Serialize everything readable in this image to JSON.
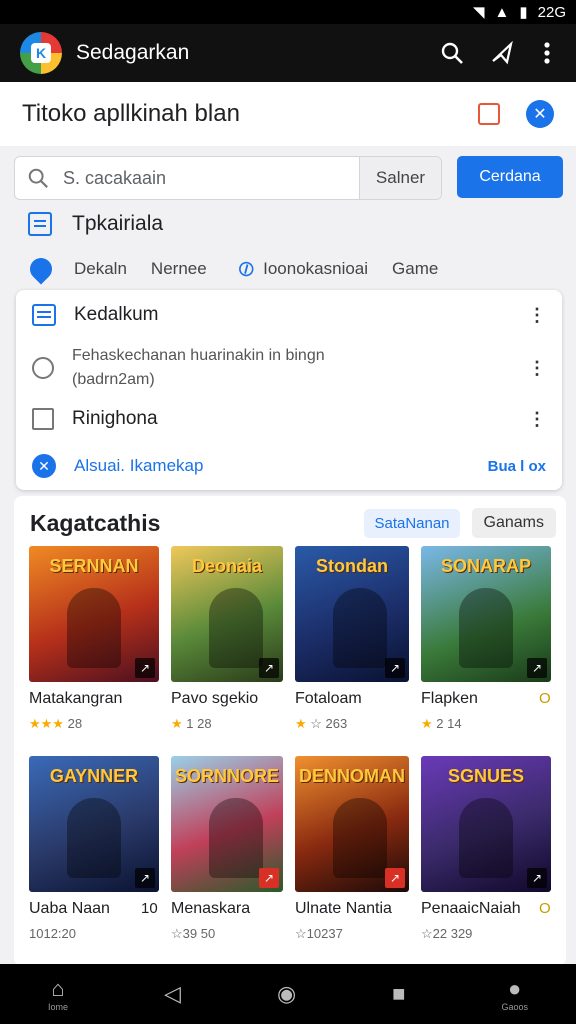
{
  "status": {
    "right_text": "22G"
  },
  "appbar": {
    "title": "Sedagarkan",
    "logo_glyph": "K"
  },
  "header": {
    "title": "Titoko apllkinah blan"
  },
  "search": {
    "placeholder": "S. cacakaain",
    "side_button": "Salner",
    "primary_button": "Cerdana"
  },
  "section": {
    "title": "Tpkairiala"
  },
  "chips": {
    "a": "Dekaln",
    "b": "Nernee",
    "c": "Ioonokasnioai",
    "d": "Game"
  },
  "card": {
    "row1": "Kedalkum",
    "row2_line1": "Fehaskechanan huarinakin in bingn",
    "row2_line2": "(badrn2am)",
    "row3": "Rinighona",
    "link": "Alsuai. Ikamekap",
    "link_right": "Bua l ox"
  },
  "games": {
    "title": "Kagatcathis",
    "pill_active": "SataNanan",
    "pill": "Ganams",
    "items": [
      {
        "art": "SERNNAN",
        "name": "Matakangran",
        "stars": "★★★",
        "meta": "28",
        "bg": "linear-gradient(160deg,#f08a24,#b6301a 55%,#4a1020)"
      },
      {
        "art": "Deonaia",
        "name": "Pavo sgekio",
        "stars": "★",
        "meta": "1 28",
        "bg": "linear-gradient(160deg,#f0c85a,#5a8a3a 55%,#2a3a1a)"
      },
      {
        "art": "Stondan",
        "name": "Fotaloam",
        "stars": "★",
        "meta": "☆ 263",
        "bg": "linear-gradient(160deg,#2a5aa8,#1c2e6a 55%,#0a1230)"
      },
      {
        "art": "SONARAP",
        "name": "Flapken",
        "stars": "★",
        "meta": "2 14",
        "bg": "linear-gradient(160deg,#7ab8e8,#3a7a3a 60%,#1a3a1a)",
        "extra": "O"
      },
      {
        "art": "GAYNNER",
        "name": "Uaba Naan",
        "stars": "",
        "meta": "1012:20",
        "bg": "linear-gradient(160deg,#3a6ab8,#2a3a6a 55%,#0a1230)",
        "extra": "10"
      },
      {
        "art": "SORNNORE",
        "name": "Menaskara",
        "stars": "",
        "meta": "☆39 50",
        "bg": "linear-gradient(160deg,#9ad0e8,#c0405a 55%,#2a5a2a)"
      },
      {
        "art": "DENNOMAN",
        "name": "Ulnate Nantia",
        "stars": "",
        "meta": "☆10237",
        "bg": "linear-gradient(160deg,#f09030,#8a2a10 55%,#1a0a08)"
      },
      {
        "art": "SGNUES",
        "name": "PenaaicNaiah",
        "stars": "",
        "meta": "☆22 329",
        "bg": "linear-gradient(160deg,#6a3ab8,#3a2a6a 55%,#10082a)",
        "extra": "O"
      }
    ]
  },
  "nav": {
    "home": "Iome",
    "games": "Gaoos"
  }
}
